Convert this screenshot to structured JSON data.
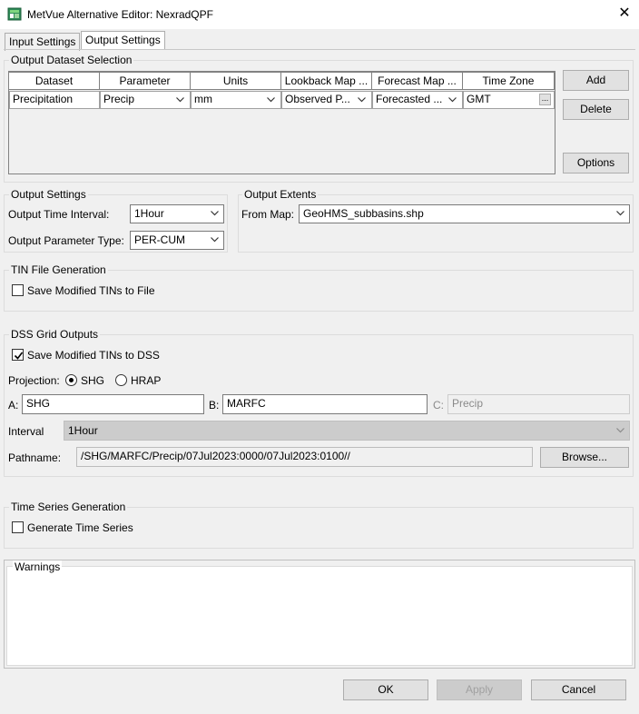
{
  "window": {
    "title": "MetVue Alternative Editor: NexradQPF",
    "close_glyph": "✕"
  },
  "tabs": [
    {
      "label": "Input Settings"
    },
    {
      "label": "Output Settings"
    }
  ],
  "dataset_selection": {
    "legend": "Output Dataset Selection",
    "columns": [
      "Dataset",
      "Parameter",
      "Units",
      "Lookback Map ...",
      "Forecast Map ...",
      "Time Zone"
    ],
    "row": {
      "dataset": "Precipitation",
      "parameter": "Precip",
      "units": "mm",
      "lookback": "Observed P...",
      "forecast": "Forecasted ...",
      "timezone": "GMT",
      "timezone_button": "..."
    },
    "buttons": {
      "add": "Add",
      "delete": "Delete",
      "options": "Options"
    }
  },
  "output_settings": {
    "legend": "Output Settings",
    "interval_label": "Output Time Interval:",
    "interval_value": "1Hour",
    "param_type_label": "Output Parameter Type:",
    "param_type_value": "PER-CUM"
  },
  "output_extents": {
    "legend": "Output Extents",
    "from_map_label": "From Map:",
    "from_map_value": "GeoHMS_subbasins.shp"
  },
  "tin": {
    "legend": "TIN File Generation",
    "save_label": "Save Modified TINs to File",
    "checked": false
  },
  "dss": {
    "legend": "DSS Grid Outputs",
    "save_label": "Save Modified TINs to DSS",
    "checked": true,
    "projection_label": "Projection:",
    "projection_options": [
      "SHG",
      "HRAP"
    ],
    "projection_selected": "SHG",
    "a_label": "A:",
    "a_value": "SHG",
    "b_label": "B:",
    "b_value": "MARFC",
    "c_label": "C:",
    "c_value": "Precip",
    "interval_label": "Interval",
    "interval_value": "1Hour",
    "pathname_label": "Pathname:",
    "pathname_value": "/SHG/MARFC/Precip/07Jul2023:0000/07Jul2023:0100//",
    "browse_label": "Browse..."
  },
  "timeseries": {
    "legend": "Time Series Generation",
    "label": "Generate Time Series",
    "checked": false
  },
  "warnings": {
    "legend": "Warnings"
  },
  "footer": {
    "ok": "OK",
    "apply": "Apply",
    "cancel": "Cancel"
  }
}
